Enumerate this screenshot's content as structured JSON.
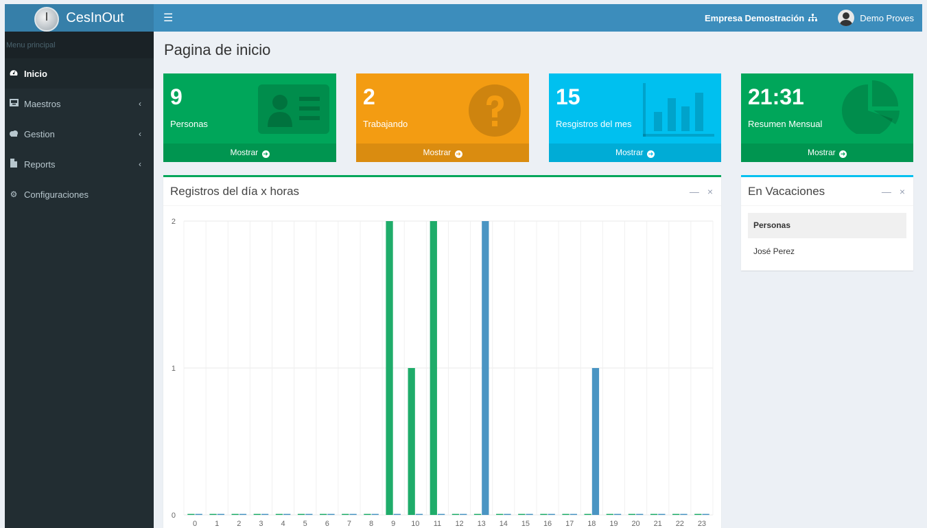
{
  "app": {
    "title": "CesInOut"
  },
  "header": {
    "company": "Empresa Demostración",
    "user": "Demo Proves"
  },
  "sidebar": {
    "header": "Menu principal",
    "items": [
      {
        "label": "Inicio",
        "icon": "dashboard-icon",
        "active": true
      },
      {
        "label": "Maestros",
        "icon": "inbox-icon",
        "has_children": true
      },
      {
        "label": "Gestion",
        "icon": "cloud-icon",
        "has_children": true
      },
      {
        "label": "Reports",
        "icon": "file-icon",
        "has_children": true
      },
      {
        "label": "Configuraciones",
        "icon": "gear-icon"
      }
    ]
  },
  "page": {
    "title": "Pagina de inicio"
  },
  "info_boxes": [
    {
      "value": "9",
      "label": "Personas",
      "link": "Mostrar",
      "color": "#00a65a",
      "icon": "id-card-icon"
    },
    {
      "value": "2",
      "label": "Trabajando",
      "link": "Mostrar",
      "color": "#f39c12",
      "icon": "question-icon"
    },
    {
      "value": "15",
      "label": "Resgistros del mes",
      "link": "Mostrar",
      "color": "#00c0ef",
      "icon": "bar-chart-icon"
    },
    {
      "value": "21:31",
      "label": "Resumen Mensual",
      "link": "Mostrar",
      "color": "#00a65a",
      "icon": "pie-chart-icon"
    }
  ],
  "chart_panel": {
    "title": "Registros del día x horas",
    "accent": "#00a65a"
  },
  "vacation_panel": {
    "title": "En Vacaciones",
    "column": "Personas",
    "rows": [
      "José Perez"
    ],
    "accent": "#00c0ef"
  },
  "chart_data": {
    "type": "bar",
    "categories": [
      "0",
      "1",
      "2",
      "3",
      "4",
      "5",
      "6",
      "7",
      "8",
      "9",
      "10",
      "11",
      "12",
      "13",
      "14",
      "15",
      "16",
      "17",
      "18",
      "19",
      "20",
      "21",
      "22",
      "23"
    ],
    "series": [
      {
        "color": "#1fac6a",
        "values": [
          0,
          0,
          0,
          0,
          0,
          0,
          0,
          0,
          0,
          2,
          1,
          2,
          0,
          0,
          0,
          0,
          0,
          0,
          0,
          0,
          0,
          0,
          0,
          0
        ]
      },
      {
        "color": "#4a95c3",
        "values": [
          0,
          0,
          0,
          0,
          0,
          0,
          0,
          0,
          0,
          0,
          0,
          0,
          0,
          2,
          0,
          0,
          0,
          0,
          1,
          0,
          0,
          0,
          0,
          0
        ]
      }
    ],
    "yticks": [
      0,
      1,
      2
    ],
    "ylim": [
      0,
      2
    ],
    "grid": true
  }
}
